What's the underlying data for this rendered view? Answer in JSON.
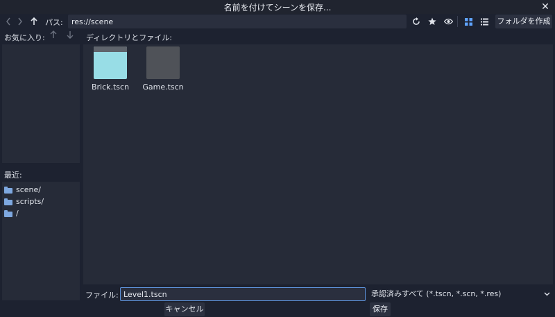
{
  "dialog": {
    "title": "名前を付けてシーンを保存...",
    "close_glyph": "✕"
  },
  "toolbar": {
    "path_label": "パス:",
    "path_value": "res://scene",
    "make_folder_label": "フォルダを作成"
  },
  "favorites": {
    "label": "お気に入り:"
  },
  "directories": {
    "label": "ディレクトリとファイル:"
  },
  "recent": {
    "label": "最近:",
    "items": [
      {
        "label": "scene/"
      },
      {
        "label": "scripts/"
      },
      {
        "label": "/"
      }
    ]
  },
  "files": [
    {
      "name": "Brick.tscn",
      "thumb_color": "#98dde6"
    },
    {
      "name": "Game.tscn",
      "thumb_color": "#4f5258"
    }
  ],
  "footer": {
    "file_label": "ファイル:",
    "file_value": "Level1.tscn",
    "filter_value": "承認済みすべて (*.tscn, *.scn, *.res)",
    "cancel_label": "キャンセル",
    "save_label": "保存"
  },
  "colors": {
    "background": "#1d2230",
    "panel": "#262b38",
    "accent": "#5fa3ff",
    "folder": "#7ea8e0"
  }
}
